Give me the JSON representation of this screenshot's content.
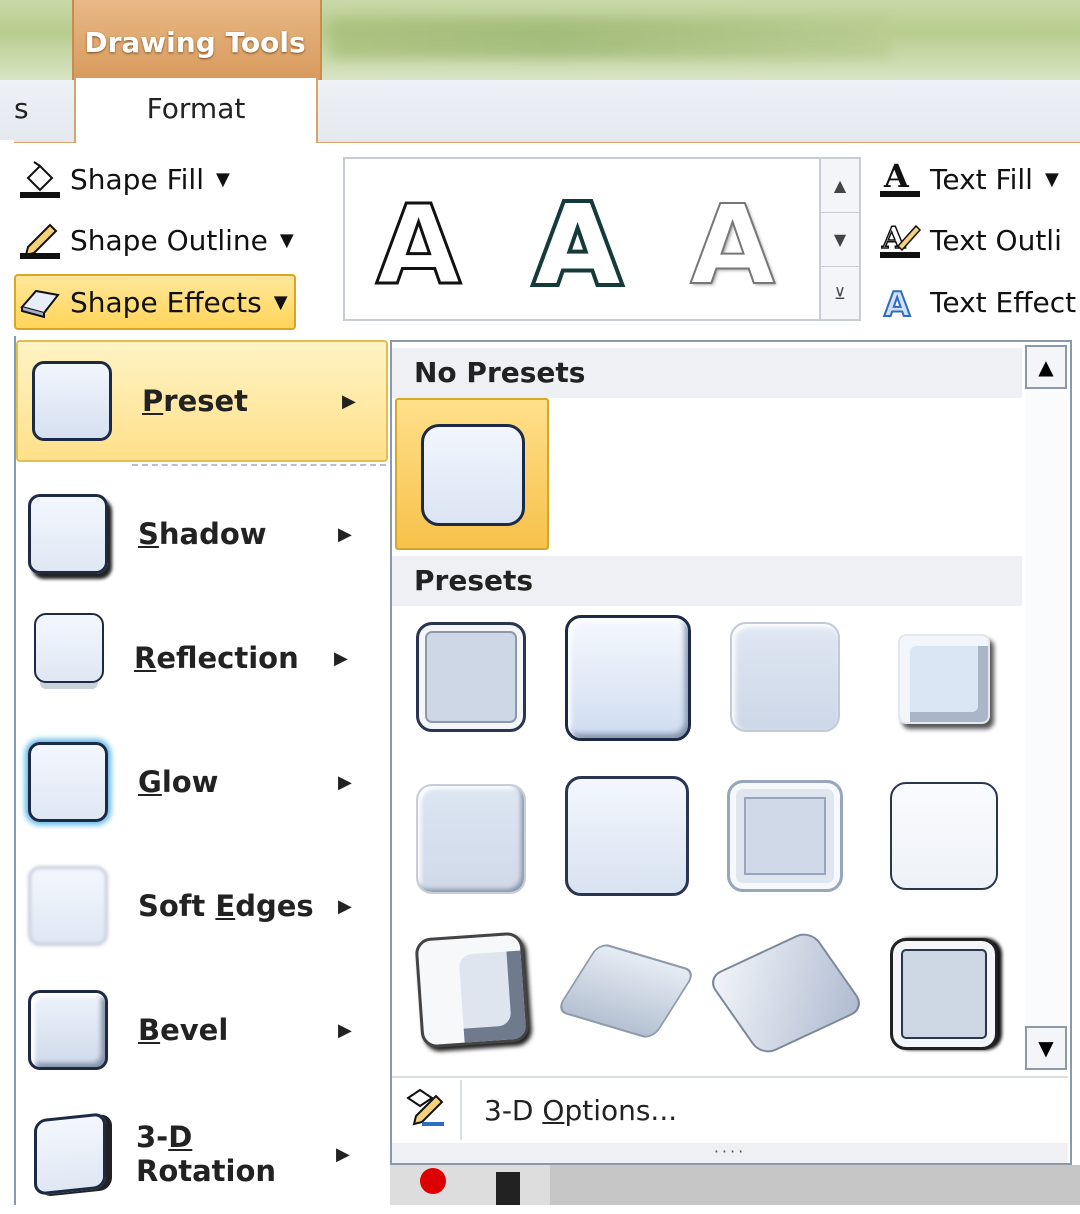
{
  "titlebar": {
    "context_group": "Drawing Tools"
  },
  "tabs": {
    "previous_partial": "s",
    "active": "Format"
  },
  "ribbon": {
    "shape_fill": "Shape Fill",
    "shape_outline": "Shape Outline",
    "shape_effects": "Shape Effects",
    "text_fill": "Text Fill",
    "text_outline": "Text Outli",
    "text_effects": "Text Effect",
    "wordart_styles": [
      "A",
      "A",
      "A"
    ]
  },
  "menu": {
    "items": [
      {
        "label": "Preset",
        "accel": "P",
        "rest": "reset"
      },
      {
        "label": "Shadow",
        "accel": "S",
        "rest": "hadow"
      },
      {
        "label": "Reflection",
        "accel": "R",
        "rest": "eflection"
      },
      {
        "label": "Glow",
        "accel": "G",
        "rest": "low"
      },
      {
        "label": "Soft Edges",
        "pre": "Soft ",
        "accel": "E",
        "rest": "dges"
      },
      {
        "label": "Bevel",
        "accel": "B",
        "rest": "evel"
      },
      {
        "label": "3-D Rotation",
        "pre": "3-",
        "accel": "D",
        "rest": " Rotation"
      }
    ]
  },
  "submenu": {
    "no_presets_header": "No Presets",
    "presets_header": "Presets",
    "options_pre": "3-D ",
    "options_accel": "O",
    "options_rest": "ptions...",
    "grip": "····"
  }
}
